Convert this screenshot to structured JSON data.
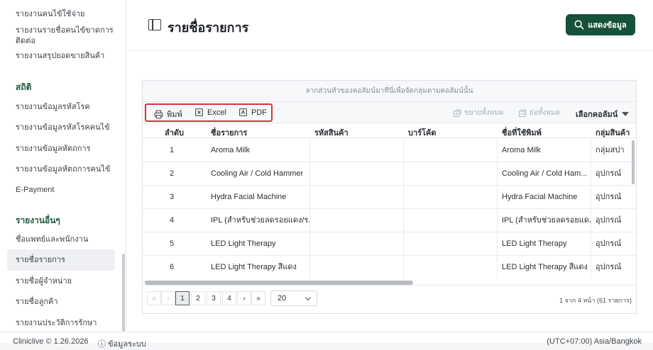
{
  "sidebar": {
    "items_top": [
      "รายงานคนไข้ใช้จ่าย",
      "รายงานรายชื่อคนไข้ขาดการติดต่อ",
      "รายงานสรุปยอดขายสินค้า"
    ],
    "section_stats": "สถิติ",
    "items_stats": [
      "รายงานข้อมูลรหัสโรค",
      "รายงานข้อมูลรหัสโรคคนไข้",
      "รายงานข้อมูลหัตถการ",
      "รายงานข้อมูลหัตถการคนไข้",
      "E-Payment"
    ],
    "section_other": "รายงานอื่นๆ",
    "items_other": [
      "ชื่อแพทย์และพนักงาน",
      "รายชื่อรายการ",
      "รายชื่อผู้จำหน่าย",
      "รายชื่อลูกค้า",
      "รายงานประวัติการรักษา"
    ]
  },
  "header": {
    "title": "รายชื่อรายการ",
    "show_button": "แสดงข้อมูล"
  },
  "grid": {
    "group_hint": "ลากส่วนหัวของคอลัมน์มาที่นี่เพื่อจัดกลุ่มตามคอลัมน์นั้น",
    "toolbar": {
      "print": "พิมพ์",
      "excel": "Excel",
      "pdf": "PDF",
      "expand_all": "ขยายทั้งหมด",
      "collapse_all": "ย่อทั้งหมด",
      "choose_columns": "เลือกคอลัมน์"
    },
    "columns": [
      "ลำดับ",
      "ชื่อรายการ",
      "รหัสสินค้า",
      "บาร์โค้ด",
      "ชื่อที่ใช้พิมพ์",
      "กลุ่มสินค้า"
    ],
    "rows": [
      [
        "1",
        "Aroma Milk",
        "",
        "",
        "Aroma Milk",
        "กลุ่มสปา"
      ],
      [
        "2",
        "Cooling Air / Cold Hammer",
        "",
        "",
        "Cooling Air / Cold Ham...",
        "อุปกรณ์"
      ],
      [
        "3",
        "Hydra Facial Machine",
        "",
        "",
        "Hydra Facial Machine",
        "อุปกรณ์"
      ],
      [
        "4",
        "IPL (สำหรับช่วยลดรอยแดง/ร...",
        "",
        "",
        "IPL (สำหรับช่วยลดรอยแด...",
        "อุปกรณ์"
      ],
      [
        "5",
        "LED Light Therapy",
        "",
        "",
        "LED Light Therapy",
        "อุปกรณ์"
      ],
      [
        "6",
        "LED Light Therapy สีแดง",
        "",
        "",
        "LED Light Therapy สีแดง",
        "อุปกรณ์"
      ]
    ],
    "pager": {
      "first": "«",
      "prev": "‹",
      "pages": [
        "1",
        "2",
        "3",
        "4"
      ],
      "next": "›",
      "last": "»",
      "page_size": "20",
      "info": "1 จาก 4 หน้า (61 รายการ)"
    }
  },
  "footer": {
    "copyright": "Cliniclive © 1.26.2026",
    "about": "ข้อมูลระบบ",
    "timezone": "(UTC+07:00) Asia/Bangkok"
  },
  "colors": {
    "brand": "#145239",
    "highlight": "#d9333b"
  }
}
